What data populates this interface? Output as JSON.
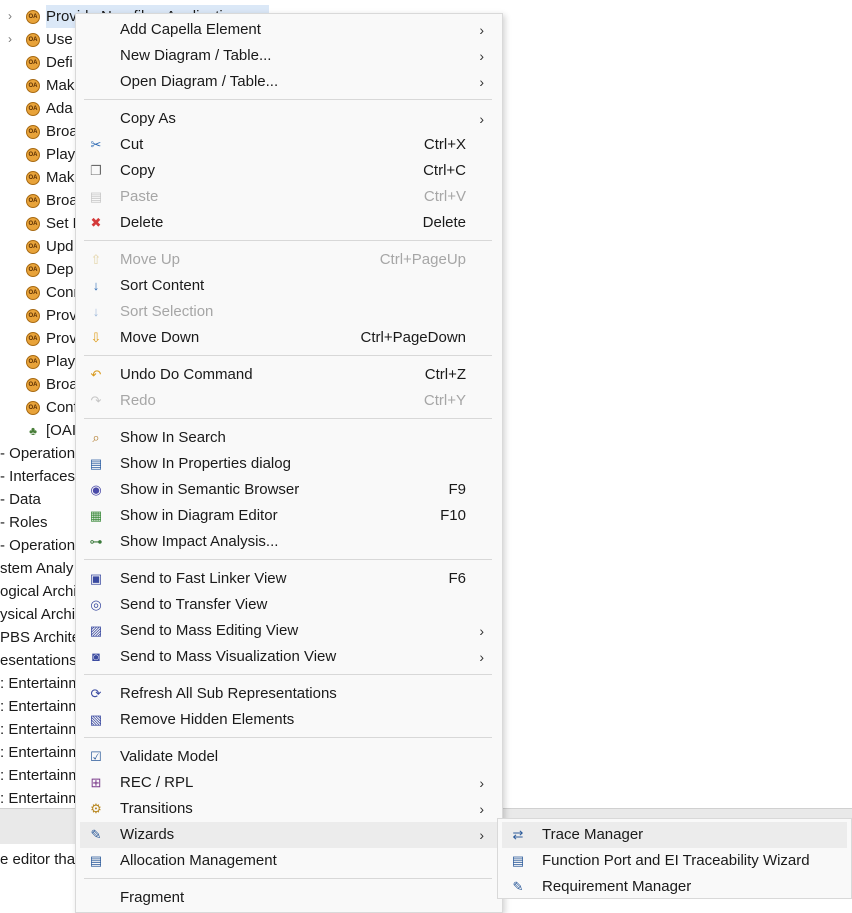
{
  "tree": {
    "items": [
      {
        "label": "Provide Non-fiber Application",
        "icon": "functional-chain-icon",
        "expandable": true,
        "selected": true
      },
      {
        "label": "Use",
        "icon": "functional-chain-icon",
        "expandable": true
      },
      {
        "label": "Defi",
        "icon": "functional-chain-icon"
      },
      {
        "label": "Mak",
        "icon": "functional-chain-icon"
      },
      {
        "label": "Ada",
        "icon": "functional-chain-icon"
      },
      {
        "label": "Broa",
        "icon": "functional-chain-icon"
      },
      {
        "label": "Play",
        "icon": "functional-chain-icon"
      },
      {
        "label": "Mak",
        "icon": "functional-chain-icon"
      },
      {
        "label": "Broa",
        "icon": "functional-chain-icon"
      },
      {
        "label": "Set F",
        "icon": "functional-chain-icon"
      },
      {
        "label": "Upd",
        "icon": "functional-chain-icon"
      },
      {
        "label": "Dep",
        "icon": "functional-chain-icon"
      },
      {
        "label": "Conr",
        "icon": "functional-chain-icon"
      },
      {
        "label": "Prov",
        "icon": "functional-chain-icon"
      },
      {
        "label": "Prov",
        "icon": "functional-chain-icon"
      },
      {
        "label": "Play",
        "icon": "functional-chain-icon"
      },
      {
        "label": "Broa",
        "icon": "functional-chain-icon"
      },
      {
        "label": "Conf",
        "icon": "functional-chain-icon"
      },
      {
        "label": "[OAI",
        "icon": "structure-icon"
      }
    ],
    "top_items": [
      "- Operation",
      "- Interfaces",
      "- Data",
      "- Roles",
      "- Operation",
      "stem Analy",
      "ogical Archit",
      "ysical Archi",
      "PBS Architec",
      "esentations",
      ": Entertainm",
      ": Entertainm",
      ": Entertainm",
      ": Entertainm",
      ": Entertainm",
      ": Entertainm"
    ]
  },
  "status": {
    "text": "e editor that"
  },
  "menu": {
    "groups": [
      [
        {
          "label": "Add Capella Element",
          "shortcut": "",
          "submenu": true,
          "icon": ""
        },
        {
          "label": "New Diagram / Table...",
          "shortcut": "",
          "submenu": true,
          "icon": ""
        },
        {
          "label": "Open Diagram / Table...",
          "shortcut": "",
          "submenu": true,
          "icon": ""
        }
      ],
      [
        {
          "label": "Copy As",
          "shortcut": "",
          "submenu": true,
          "icon": ""
        },
        {
          "label": "Cut",
          "shortcut": "Ctrl+X",
          "icon": "scissors-icon"
        },
        {
          "label": "Copy",
          "shortcut": "Ctrl+C",
          "icon": "copy-icon"
        },
        {
          "label": "Paste",
          "shortcut": "Ctrl+V",
          "icon": "paste-icon",
          "disabled": true
        },
        {
          "label": "Delete",
          "shortcut": "Delete",
          "icon": "delete-icon"
        }
      ],
      [
        {
          "label": "Move Up",
          "shortcut": "Ctrl+PageUp",
          "icon": "arrow-up-icon",
          "disabled": true
        },
        {
          "label": "Sort Content",
          "shortcut": "",
          "icon": "sort-az-icon"
        },
        {
          "label": "Sort Selection",
          "shortcut": "",
          "icon": "sort-az-icon",
          "disabled": true
        },
        {
          "label": "Move Down",
          "shortcut": "Ctrl+PageDown",
          "icon": "arrow-down-icon"
        }
      ],
      [
        {
          "label": "Undo Do Command",
          "shortcut": "Ctrl+Z",
          "icon": "undo-icon"
        },
        {
          "label": "Redo",
          "shortcut": "Ctrl+Y",
          "icon": "redo-icon",
          "disabled": true
        }
      ],
      [
        {
          "label": "Show In Search",
          "shortcut": "",
          "icon": "search-icon"
        },
        {
          "label": "Show In Properties dialog",
          "shortcut": "",
          "icon": "properties-icon"
        },
        {
          "label": "Show in Semantic Browser",
          "shortcut": "F9",
          "icon": "semantic-browser-icon"
        },
        {
          "label": "Show in Diagram Editor",
          "shortcut": "F10",
          "icon": "diagram-icon"
        },
        {
          "label": "Show Impact Analysis...",
          "shortcut": "",
          "icon": "impact-analysis-icon"
        }
      ],
      [
        {
          "label": "Send to Fast Linker View",
          "shortcut": "F6",
          "icon": "fast-linker-icon"
        },
        {
          "label": "Send to Transfer View",
          "shortcut": "",
          "icon": "transfer-icon"
        },
        {
          "label": "Send to Mass Editing View",
          "shortcut": "",
          "submenu": true,
          "icon": "mass-edit-icon"
        },
        {
          "label": "Send to Mass Visualization View",
          "shortcut": "",
          "submenu": true,
          "icon": "mass-visualization-icon"
        }
      ],
      [
        {
          "label": "Refresh All Sub Representations",
          "shortcut": "",
          "icon": "refresh-icon"
        },
        {
          "label": "Remove Hidden Elements",
          "shortcut": "",
          "icon": "remove-hidden-icon"
        }
      ],
      [
        {
          "label": "Validate Model",
          "shortcut": "",
          "icon": "validate-icon"
        },
        {
          "label": "REC / RPL",
          "shortcut": "",
          "submenu": true,
          "icon": "rec-rpl-icon"
        },
        {
          "label": "Transitions",
          "shortcut": "",
          "submenu": true,
          "icon": "transitions-icon"
        },
        {
          "label": "Wizards",
          "shortcut": "",
          "submenu": true,
          "icon": "wizard-icon",
          "highlighted": true
        },
        {
          "label": "Allocation Management",
          "shortcut": "",
          "icon": "allocation-icon"
        }
      ],
      [
        {
          "label": "Fragment",
          "shortcut": "",
          "icon": ""
        }
      ]
    ]
  },
  "submenu": {
    "items": [
      {
        "label": "Trace Manager",
        "icon": "trace-manager-icon",
        "highlighted": true
      },
      {
        "label": "Function Port and EI Traceability Wizard",
        "icon": "table-icon"
      },
      {
        "label": "Requirement Manager",
        "icon": "requirement-icon"
      }
    ]
  },
  "colors": {
    "selection": "#dbe8f7",
    "menu_bg": "#f9f9f9",
    "highlight": "#ececec",
    "disabled_text": "#a6a6a6",
    "delete_red": "#d43a3a"
  }
}
